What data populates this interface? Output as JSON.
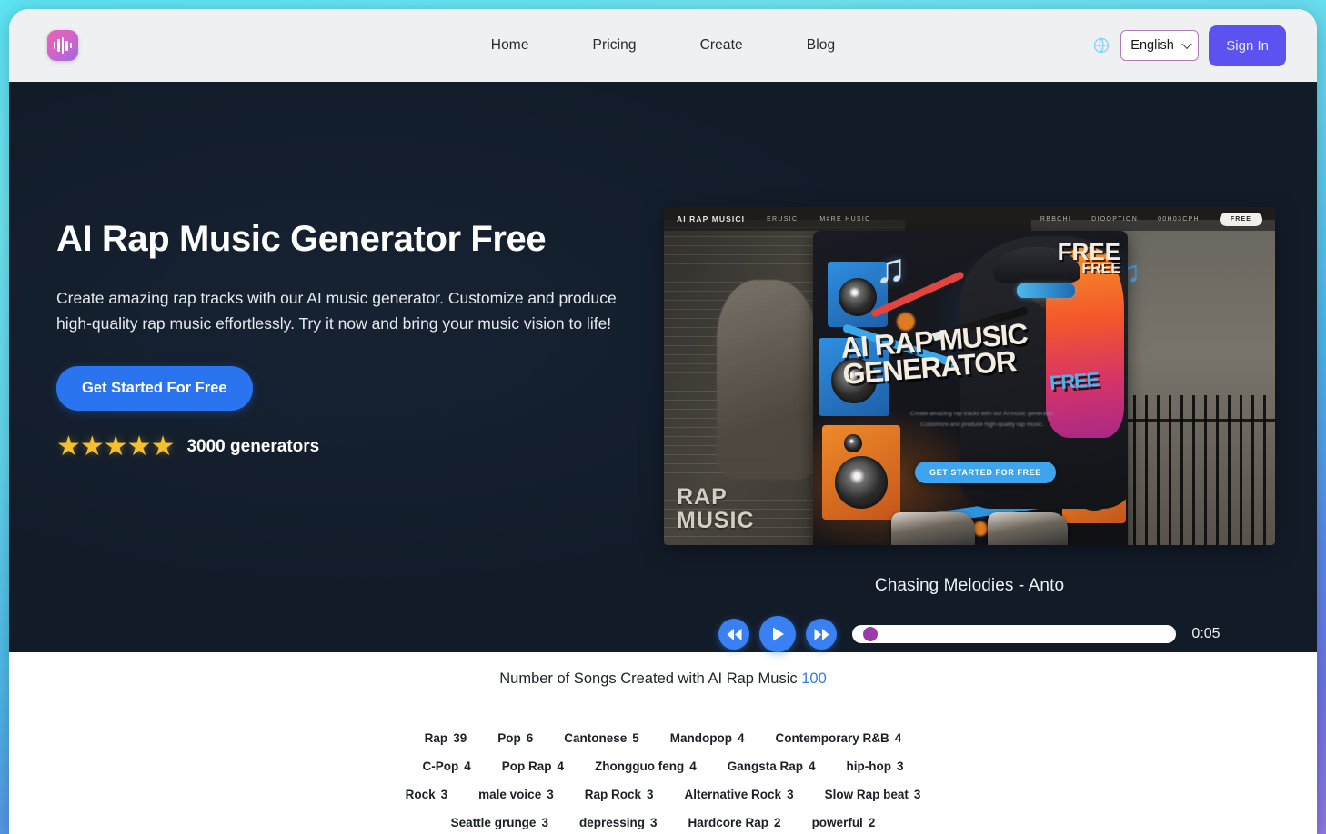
{
  "header": {
    "logo_icon": "audio-waveform-icon",
    "nav": [
      {
        "label": "Home"
      },
      {
        "label": "Pricing"
      },
      {
        "label": "Create"
      },
      {
        "label": "Blog"
      }
    ],
    "globe_icon": "globe-icon",
    "language": {
      "selected": "English",
      "options": [
        "English"
      ]
    },
    "signin_label": "Sign In",
    "colors": {
      "bar_bg": "#eff0f2",
      "signin_bg": "#5b52ef",
      "select_border": "#b07cb8"
    }
  },
  "hero": {
    "title": "AI Rap Music Generator Free",
    "subtitle": "Create amazing rap tracks with our AI music generator. Customize and produce high-quality rap music effortlessly. Try it now and bring your music vision to life!",
    "cta_label": "Get Started For Free",
    "stars": "★★★★★",
    "rating_label": "3000 generators",
    "background_color": "#121c29",
    "cta_color": "#2a74f0",
    "star_color": "#f5c02b"
  },
  "artwork": {
    "nav_brand": "AI RAP MUSICI",
    "nav_gibberish_left": [
      "ERUSIC",
      "M#RE HUSIC"
    ],
    "nav_gibberish_right": [
      "RBBCHI",
      "DIOOPTION",
      "00H03CPH"
    ],
    "nav_pill": "FREE",
    "wall_text": "RAP\nMUSIC",
    "poster_title": "AI RAP MUSIC GENERATOR",
    "poster_title_accent": "FREE",
    "poster_body": "Create amazing rap tracks with our AI music generator. Customize and produce high-quality rap music.",
    "poster_button": "GET STARTED FOR FREE",
    "free_badge_big": "FREE",
    "free_badge_small": "FREE"
  },
  "player": {
    "track_title": "Chasing Melodies - Anto",
    "rewind_icon": "rewind-icon",
    "play_icon": "play-icon",
    "forward_icon": "fast-forward-icon",
    "time": "0:05",
    "progress_percent": 2,
    "button_color": "#3a80f5",
    "thumb_color": "#9b3bab"
  },
  "stats": {
    "heading_text": "Number of Songs Created with AI Rap Music",
    "heading_count": "100",
    "count_color": "#2f7fe8",
    "tag_rows": [
      [
        {
          "label": "Rap",
          "count": "39"
        },
        {
          "label": "Pop",
          "count": "6"
        },
        {
          "label": "Cantonese",
          "count": "5"
        },
        {
          "label": "Mandopop",
          "count": "4"
        },
        {
          "label": "Contemporary R&B",
          "count": "4"
        }
      ],
      [
        {
          "label": "C-Pop",
          "count": "4"
        },
        {
          "label": "Pop Rap",
          "count": "4"
        },
        {
          "label": "Zhongguo feng",
          "count": "4"
        },
        {
          "label": "Gangsta Rap",
          "count": "4"
        },
        {
          "label": "hip-hop",
          "count": "3"
        }
      ],
      [
        {
          "label": "Rock",
          "count": "3"
        },
        {
          "label": "male voice",
          "count": "3"
        },
        {
          "label": "Rap Rock",
          "count": "3"
        },
        {
          "label": "Alternative Rock",
          "count": "3"
        },
        {
          "label": "Slow Rap beat",
          "count": "3"
        }
      ],
      [
        {
          "label": "Seattle grunge",
          "count": "3"
        },
        {
          "label": "depressing",
          "count": "3"
        },
        {
          "label": "Hardcore Rap",
          "count": "2"
        },
        {
          "label": "powerful",
          "count": "2"
        }
      ]
    ]
  }
}
